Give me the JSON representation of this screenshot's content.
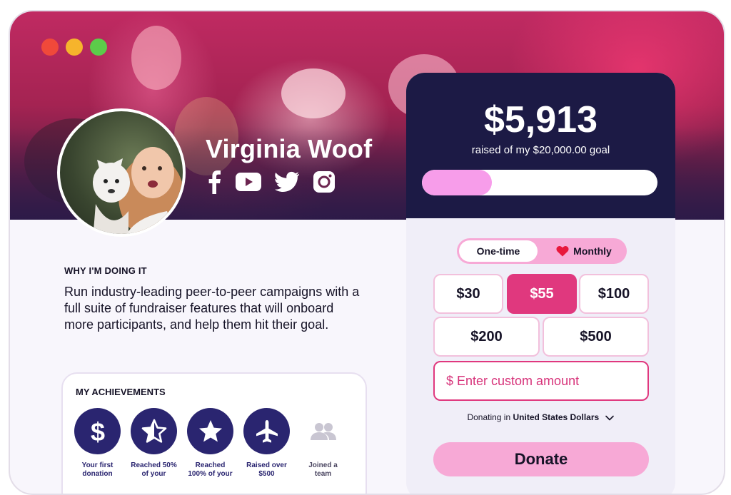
{
  "window": {
    "controls": [
      "close",
      "minimize",
      "maximize"
    ]
  },
  "profile": {
    "name": "Virginia Woof",
    "socials": [
      "facebook-icon",
      "youtube-icon",
      "twitter-icon",
      "instagram-icon"
    ]
  },
  "why": {
    "label": "WHY I'M DOING IT",
    "text": "Run industry-leading peer-to-peer campaigns with a full suite of fundraiser features that will onboard more participants, and help them hit their goal."
  },
  "achievements": {
    "title": "MY ACHIEVEMENTS",
    "badges": [
      {
        "icon": "dollar-icon",
        "label": "Your first donation"
      },
      {
        "icon": "half-star-icon",
        "label": "Reached 50% of your"
      },
      {
        "icon": "star-icon",
        "label": "Reached 100% of your"
      },
      {
        "icon": "airplane-icon",
        "label": "Raised over $500"
      },
      {
        "icon": "group-icon",
        "label": "Joined a team"
      }
    ]
  },
  "donation": {
    "raised": "$5,913",
    "goal_text": "raised of my $20,000.00 goal",
    "progress_fraction": 0.2957,
    "frequency": {
      "one_time": "One-time",
      "monthly": "Monthly",
      "selected": "One-time"
    },
    "amounts": [
      "$30",
      "$55",
      "$100",
      "$200",
      "$500"
    ],
    "selected_amount": "$55",
    "custom_placeholder": "$ Enter custom amount",
    "currency_prefix": "Donating in",
    "currency": "United States Dollars",
    "donate_label": "Donate"
  },
  "colors": {
    "accent_pink": "#e0387e",
    "navy": "#1c1a45",
    "progress": "#f79dea"
  }
}
